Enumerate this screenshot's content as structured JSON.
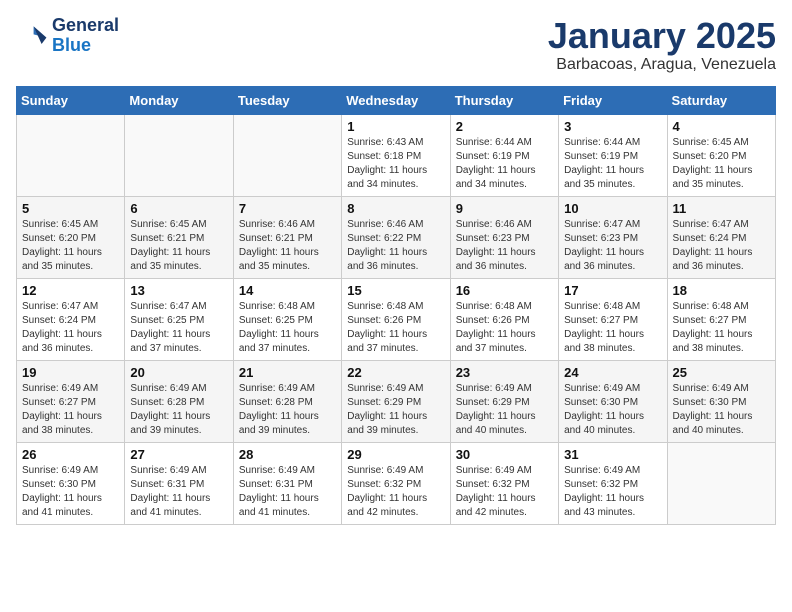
{
  "header": {
    "logo_line1": "General",
    "logo_line2": "Blue",
    "month": "January 2025",
    "location": "Barbacoas, Aragua, Venezuela"
  },
  "weekdays": [
    "Sunday",
    "Monday",
    "Tuesday",
    "Wednesday",
    "Thursday",
    "Friday",
    "Saturday"
  ],
  "weeks": [
    [
      {
        "day": "",
        "info": ""
      },
      {
        "day": "",
        "info": ""
      },
      {
        "day": "",
        "info": ""
      },
      {
        "day": "1",
        "info": "Sunrise: 6:43 AM\nSunset: 6:18 PM\nDaylight: 11 hours and 34 minutes."
      },
      {
        "day": "2",
        "info": "Sunrise: 6:44 AM\nSunset: 6:19 PM\nDaylight: 11 hours and 34 minutes."
      },
      {
        "day": "3",
        "info": "Sunrise: 6:44 AM\nSunset: 6:19 PM\nDaylight: 11 hours and 35 minutes."
      },
      {
        "day": "4",
        "info": "Sunrise: 6:45 AM\nSunset: 6:20 PM\nDaylight: 11 hours and 35 minutes."
      }
    ],
    [
      {
        "day": "5",
        "info": "Sunrise: 6:45 AM\nSunset: 6:20 PM\nDaylight: 11 hours and 35 minutes."
      },
      {
        "day": "6",
        "info": "Sunrise: 6:45 AM\nSunset: 6:21 PM\nDaylight: 11 hours and 35 minutes."
      },
      {
        "day": "7",
        "info": "Sunrise: 6:46 AM\nSunset: 6:21 PM\nDaylight: 11 hours and 35 minutes."
      },
      {
        "day": "8",
        "info": "Sunrise: 6:46 AM\nSunset: 6:22 PM\nDaylight: 11 hours and 36 minutes."
      },
      {
        "day": "9",
        "info": "Sunrise: 6:46 AM\nSunset: 6:23 PM\nDaylight: 11 hours and 36 minutes."
      },
      {
        "day": "10",
        "info": "Sunrise: 6:47 AM\nSunset: 6:23 PM\nDaylight: 11 hours and 36 minutes."
      },
      {
        "day": "11",
        "info": "Sunrise: 6:47 AM\nSunset: 6:24 PM\nDaylight: 11 hours and 36 minutes."
      }
    ],
    [
      {
        "day": "12",
        "info": "Sunrise: 6:47 AM\nSunset: 6:24 PM\nDaylight: 11 hours and 36 minutes."
      },
      {
        "day": "13",
        "info": "Sunrise: 6:47 AM\nSunset: 6:25 PM\nDaylight: 11 hours and 37 minutes."
      },
      {
        "day": "14",
        "info": "Sunrise: 6:48 AM\nSunset: 6:25 PM\nDaylight: 11 hours and 37 minutes."
      },
      {
        "day": "15",
        "info": "Sunrise: 6:48 AM\nSunset: 6:26 PM\nDaylight: 11 hours and 37 minutes."
      },
      {
        "day": "16",
        "info": "Sunrise: 6:48 AM\nSunset: 6:26 PM\nDaylight: 11 hours and 37 minutes."
      },
      {
        "day": "17",
        "info": "Sunrise: 6:48 AM\nSunset: 6:27 PM\nDaylight: 11 hours and 38 minutes."
      },
      {
        "day": "18",
        "info": "Sunrise: 6:48 AM\nSunset: 6:27 PM\nDaylight: 11 hours and 38 minutes."
      }
    ],
    [
      {
        "day": "19",
        "info": "Sunrise: 6:49 AM\nSunset: 6:27 PM\nDaylight: 11 hours and 38 minutes."
      },
      {
        "day": "20",
        "info": "Sunrise: 6:49 AM\nSunset: 6:28 PM\nDaylight: 11 hours and 39 minutes."
      },
      {
        "day": "21",
        "info": "Sunrise: 6:49 AM\nSunset: 6:28 PM\nDaylight: 11 hours and 39 minutes."
      },
      {
        "day": "22",
        "info": "Sunrise: 6:49 AM\nSunset: 6:29 PM\nDaylight: 11 hours and 39 minutes."
      },
      {
        "day": "23",
        "info": "Sunrise: 6:49 AM\nSunset: 6:29 PM\nDaylight: 11 hours and 40 minutes."
      },
      {
        "day": "24",
        "info": "Sunrise: 6:49 AM\nSunset: 6:30 PM\nDaylight: 11 hours and 40 minutes."
      },
      {
        "day": "25",
        "info": "Sunrise: 6:49 AM\nSunset: 6:30 PM\nDaylight: 11 hours and 40 minutes."
      }
    ],
    [
      {
        "day": "26",
        "info": "Sunrise: 6:49 AM\nSunset: 6:30 PM\nDaylight: 11 hours and 41 minutes."
      },
      {
        "day": "27",
        "info": "Sunrise: 6:49 AM\nSunset: 6:31 PM\nDaylight: 11 hours and 41 minutes."
      },
      {
        "day": "28",
        "info": "Sunrise: 6:49 AM\nSunset: 6:31 PM\nDaylight: 11 hours and 41 minutes."
      },
      {
        "day": "29",
        "info": "Sunrise: 6:49 AM\nSunset: 6:32 PM\nDaylight: 11 hours and 42 minutes."
      },
      {
        "day": "30",
        "info": "Sunrise: 6:49 AM\nSunset: 6:32 PM\nDaylight: 11 hours and 42 minutes."
      },
      {
        "day": "31",
        "info": "Sunrise: 6:49 AM\nSunset: 6:32 PM\nDaylight: 11 hours and 43 minutes."
      },
      {
        "day": "",
        "info": ""
      }
    ]
  ]
}
